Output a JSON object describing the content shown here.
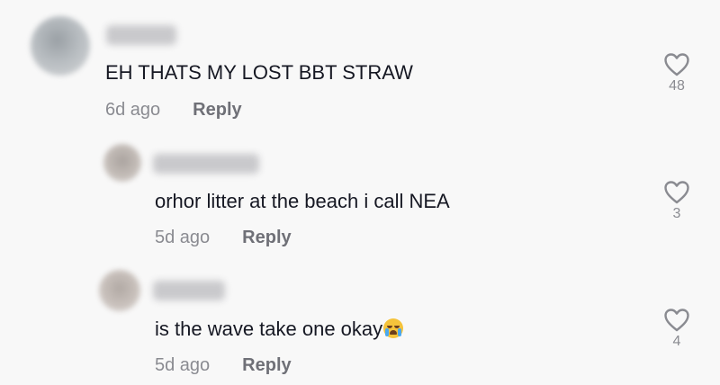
{
  "comments": [
    {
      "text": "EH THATS MY LOST BBT STRAW",
      "age": "6d ago",
      "reply_label": "Reply",
      "likes": "48",
      "avatar_color": "#b7bcc0"
    },
    {
      "text": "orhor litter at the beach i call NEA",
      "age": "5d ago",
      "reply_label": "Reply",
      "likes": "3",
      "avatar_color": "#c4bdb8"
    },
    {
      "text": "is the wave take one okay",
      "emoji": "loudly-crying-face-emoji",
      "age": "5d ago",
      "reply_label": "Reply",
      "likes": "4",
      "avatar_color": "#c9c1bc"
    }
  ],
  "colors": {
    "background": "#f8f8f8",
    "text": "#161823",
    "muted": "#8a8b91",
    "reply": "#6f7077"
  }
}
